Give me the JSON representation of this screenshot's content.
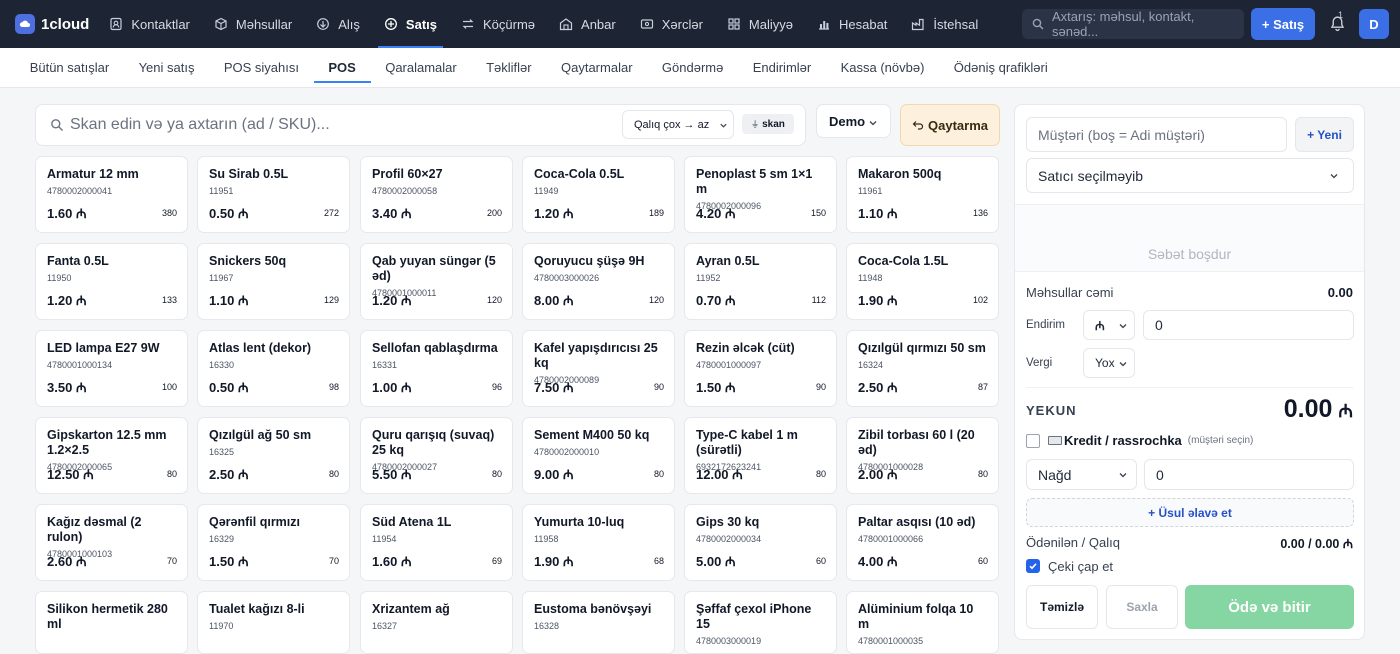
{
  "app": {
    "logo": "1cloud"
  },
  "topnav": [
    {
      "label": "Kontaktlar",
      "icon": "contacts-icon"
    },
    {
      "label": "Məhsullar",
      "icon": "box-icon"
    },
    {
      "label": "Alış",
      "icon": "purchase-icon"
    },
    {
      "label": "Satış",
      "icon": "sale-icon",
      "active": true
    },
    {
      "label": "Köçürmə",
      "icon": "transfer-icon"
    },
    {
      "label": "Anbar",
      "icon": "warehouse-icon"
    },
    {
      "label": "Xərclər",
      "icon": "expenses-icon"
    },
    {
      "label": "Maliyyə",
      "icon": "finance-icon"
    },
    {
      "label": "Hesabat",
      "icon": "report-icon"
    },
    {
      "label": "İstehsal",
      "icon": "factory-icon"
    }
  ],
  "header": {
    "search_placeholder": "Axtarış: məhsul, kontakt, sənəd...",
    "new_sale_label": "+ Satış",
    "notification_count": "1",
    "avatar_initial": "D"
  },
  "subnav": [
    {
      "label": "Bütün satışlar"
    },
    {
      "label": "Yeni satış"
    },
    {
      "label": "POS siyahısı"
    },
    {
      "label": "POS",
      "active": true
    },
    {
      "label": "Qaralamalar"
    },
    {
      "label": "Təkliflər"
    },
    {
      "label": "Qaytarmalar"
    },
    {
      "label": "Göndərmə"
    },
    {
      "label": "Endirimlər"
    },
    {
      "label": "Kassa (növbə)"
    },
    {
      "label": "Ödəniş qrafikləri"
    }
  ],
  "toolbar": {
    "search_placeholder": "Skan edin və ya axtarın (ad / SKU)...",
    "sort_value": "Qalıq çox → az",
    "scan_label": "skan",
    "warehouse_value": "Demo",
    "return_label": "Qaytarma"
  },
  "currency": "₼",
  "products": [
    {
      "name": "Armatur 12 mm",
      "sku": "4780002000041",
      "price": "1.60",
      "stock": "380"
    },
    {
      "name": "Su Sirab 0.5L",
      "sku": "11951",
      "price": "0.50",
      "stock": "272"
    },
    {
      "name": "Profil 60×27",
      "sku": "4780002000058",
      "price": "3.40",
      "stock": "200"
    },
    {
      "name": "Coca-Cola 0.5L",
      "sku": "11949",
      "price": "1.20",
      "stock": "189"
    },
    {
      "name": "Penoplast 5 sm 1×1 m",
      "sku": "4780002000096",
      "price": "4.20",
      "stock": "150"
    },
    {
      "name": "Makaron 500q",
      "sku": "11961",
      "price": "1.10",
      "stock": "136"
    },
    {
      "name": "Fanta 0.5L",
      "sku": "11950",
      "price": "1.20",
      "stock": "133"
    },
    {
      "name": "Snickers 50q",
      "sku": "11967",
      "price": "1.10",
      "stock": "129"
    },
    {
      "name": "Qab yuyan süngər (5 əd)",
      "sku": "4780001000011",
      "price": "1.20",
      "stock": "120"
    },
    {
      "name": "Qoruyucu şüşə 9H",
      "sku": "4780003000026",
      "price": "8.00",
      "stock": "120"
    },
    {
      "name": "Ayran 0.5L",
      "sku": "11952",
      "price": "0.70",
      "stock": "112"
    },
    {
      "name": "Coca-Cola 1.5L",
      "sku": "11948",
      "price": "1.90",
      "stock": "102"
    },
    {
      "name": "LED lampa E27 9W",
      "sku": "4780001000134",
      "price": "3.50",
      "stock": "100"
    },
    {
      "name": "Atlas lent (dekor)",
      "sku": "16330",
      "price": "0.50",
      "stock": "98"
    },
    {
      "name": "Sellofan qablaşdırma",
      "sku": "16331",
      "price": "1.00",
      "stock": "96"
    },
    {
      "name": "Kafel yapışdırıcısı 25 kq",
      "sku": "4780002000089",
      "price": "7.50",
      "stock": "90"
    },
    {
      "name": "Rezin əlcək (cüt)",
      "sku": "4780001000097",
      "price": "1.50",
      "stock": "90"
    },
    {
      "name": "Qızılgül qırmızı 50 sm",
      "sku": "16324",
      "price": "2.50",
      "stock": "87"
    },
    {
      "name": "Gipskarton 12.5 mm 1.2×2.5",
      "sku": "4780002000065",
      "price": "12.50",
      "stock": "80"
    },
    {
      "name": "Qızılgül ağ 50 sm",
      "sku": "16325",
      "price": "2.50",
      "stock": "80"
    },
    {
      "name": "Quru qarışıq (suvaq) 25 kq",
      "sku": "4780002000027",
      "price": "5.50",
      "stock": "80"
    },
    {
      "name": "Sement M400 50 kq",
      "sku": "4780002000010",
      "price": "9.00",
      "stock": "80"
    },
    {
      "name": "Type-C kabel 1 m (sürətli)",
      "sku": "6932172623241",
      "price": "12.00",
      "stock": "80"
    },
    {
      "name": "Zibil torbası 60 l (20 əd)",
      "sku": "4780001000028",
      "price": "2.00",
      "stock": "80"
    },
    {
      "name": "Kağız dəsmal (2 rulon)",
      "sku": "4780001000103",
      "price": "2.60",
      "stock": "70"
    },
    {
      "name": "Qərənfil qırmızı",
      "sku": "16329",
      "price": "1.50",
      "stock": "70"
    },
    {
      "name": "Süd Atena 1L",
      "sku": "11954",
      "price": "1.60",
      "stock": "69"
    },
    {
      "name": "Yumurta 10-luq",
      "sku": "11958",
      "price": "1.90",
      "stock": "68"
    },
    {
      "name": "Gips 30 kq",
      "sku": "4780002000034",
      "price": "5.00",
      "stock": "60"
    },
    {
      "name": "Paltar asqısı (10 əd)",
      "sku": "4780001000066",
      "price": "4.00",
      "stock": "60"
    },
    {
      "name": "Silikon hermetik 280 ml",
      "sku": "",
      "price": "",
      "stock": ""
    },
    {
      "name": "Tualet kağızı 8-li",
      "sku": "11970",
      "price": "",
      "stock": ""
    },
    {
      "name": "Xrizantem ağ",
      "sku": "16327",
      "price": "",
      "stock": ""
    },
    {
      "name": "Eustoma bənövşəyi",
      "sku": "16328",
      "price": "",
      "stock": ""
    },
    {
      "name": "Şəffaf çexol iPhone 15",
      "sku": "4780003000019",
      "price": "",
      "stock": ""
    },
    {
      "name": "Alüminium folqa 10 m",
      "sku": "4780001000035",
      "price": "",
      "stock": ""
    }
  ],
  "cart": {
    "customer_placeholder": "Müştəri (boş = Adi müştəri)",
    "new_customer_label": "+ Yeni",
    "seller_value": "Satıcı seçilməyib",
    "empty_text": "Səbət boşdur",
    "subtotal_label": "Məhsullar cəmi",
    "subtotal_value": "0.00",
    "discount_label": "Endirim",
    "discount_type": "₼",
    "discount_value": "0",
    "tax_label": "Vergi",
    "tax_value": "Yox",
    "total_label": "YEKUN",
    "total_value": "0.00",
    "credit_label": "Kredit / rassrochka",
    "credit_hint": "(müştəri seçin)",
    "payment_method": "Nağd",
    "payment_amount": "0",
    "add_method_label": "+ Üsul əlavə et",
    "paid_label": "Ödənilən / Qalıq",
    "paid_value": "0.00 / 0.00 ₼",
    "print_label": "Çeki çap et",
    "clear_label": "Təmizlə",
    "save_label": "Saxla",
    "pay_label": "Ödə və bitir"
  },
  "colors": {
    "topbar": "#1d2535",
    "accent": "#3b6fe6",
    "pay_button": "#86d6a3",
    "return_bg": "#fdf1dd"
  }
}
